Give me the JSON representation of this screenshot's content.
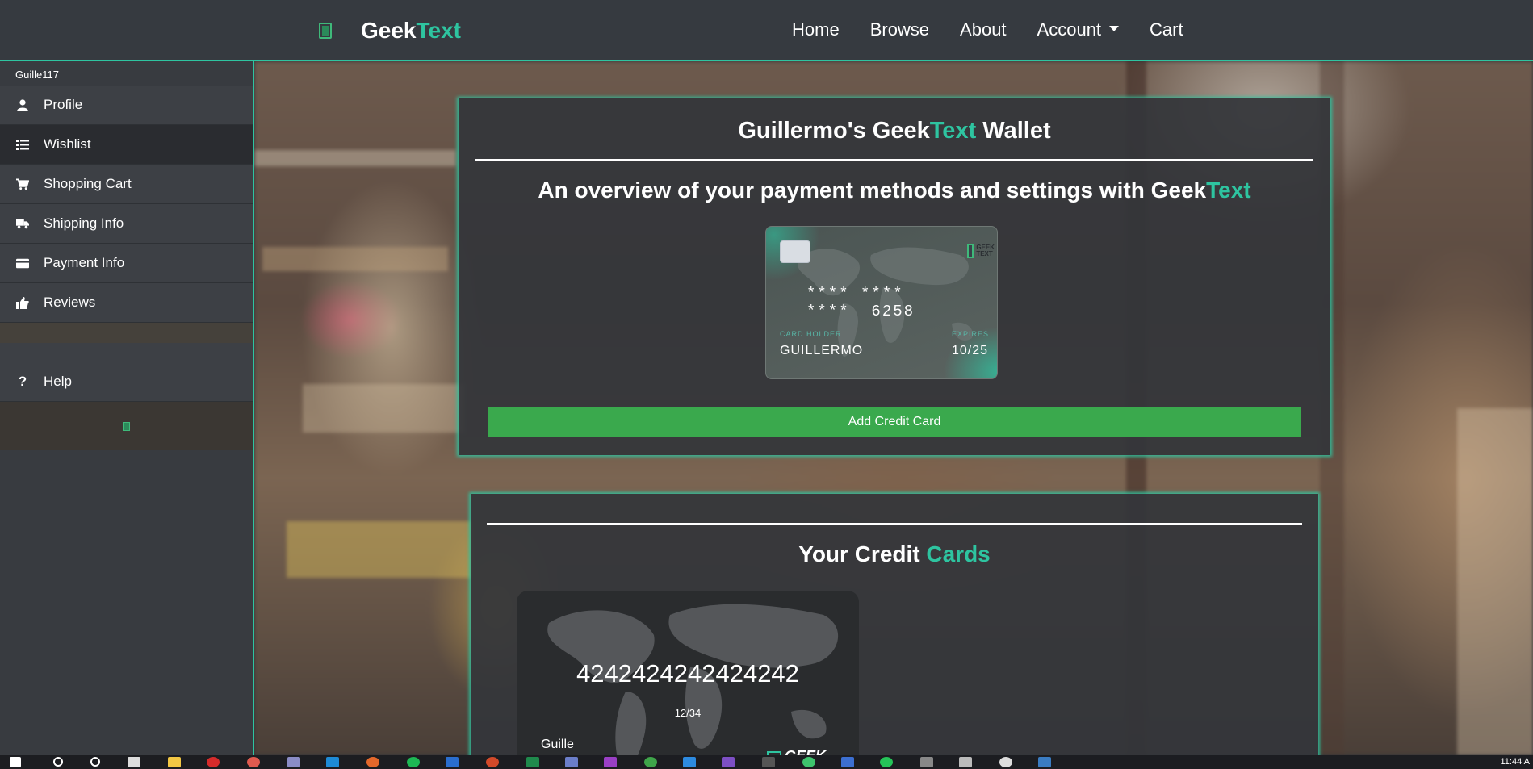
{
  "navbar": {
    "brand_part1": "Geek",
    "brand_part2": "Text",
    "links": [
      "Home",
      "Browse",
      "About",
      "Account",
      "Cart"
    ]
  },
  "sidebar": {
    "username": "Guille117",
    "items": [
      {
        "label": "Profile",
        "icon": "user-icon"
      },
      {
        "label": "Wishlist",
        "icon": "list-icon"
      },
      {
        "label": "Shopping Cart",
        "icon": "cart-icon"
      },
      {
        "label": "Shipping Info",
        "icon": "truck-icon"
      },
      {
        "label": "Payment Info",
        "icon": "credit-card-icon"
      },
      {
        "label": "Reviews",
        "icon": "thumbs-up-icon"
      }
    ],
    "help_label": "Help"
  },
  "wallet": {
    "title_part1": "Guillermo's Geek",
    "title_part2": "Text",
    "title_part3": " Wallet",
    "subtitle_part1": "An overview of your payment methods and settings with Geek",
    "subtitle_part2": "Text",
    "preview_card": {
      "number_masked": "****  ****  ****",
      "number_last4": "6258",
      "holder_label": "CARD HOLDER",
      "holder_name": "GUILLERMO",
      "expires_label": "EXPIRES",
      "expires_value": "10/25",
      "logo_text_1": "GEEK",
      "logo_text_2": "TEXT"
    },
    "add_button_label": "Add Credit Card"
  },
  "credit_cards": {
    "title_part1": "Your Credit ",
    "title_part2": "Cards",
    "cards": [
      {
        "number": "4242424242424242",
        "expiry": "12/34",
        "name": "Guille",
        "logo": "GEEK"
      }
    ]
  },
  "taskbar": {
    "clock": "11:44 A"
  },
  "colors": {
    "accent": "#2ec4a0",
    "button_green": "#3aa94d",
    "panel_dark": "#34363a",
    "navbar": "#363a40"
  }
}
